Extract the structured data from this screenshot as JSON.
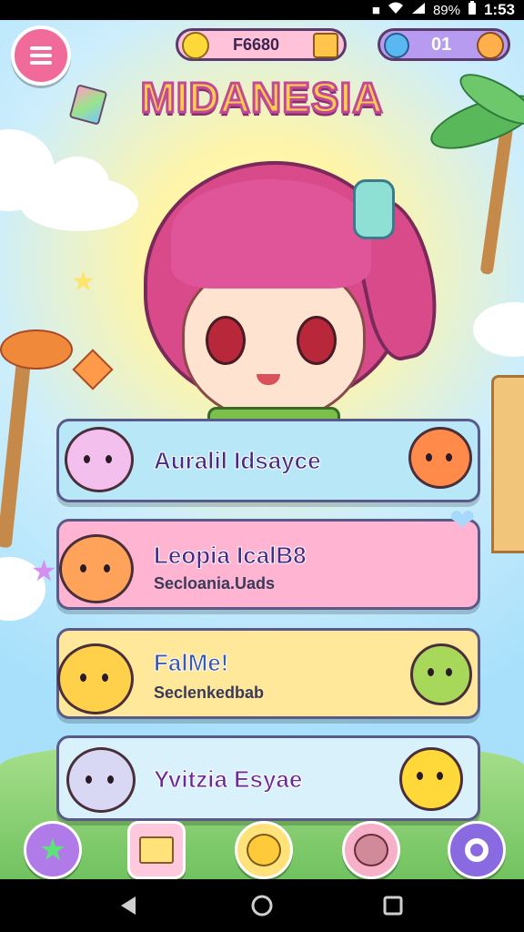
{
  "status_bar": {
    "battery": "89%",
    "time": "1:53"
  },
  "header": {
    "coins_value": "F6680",
    "gems_value": "01"
  },
  "title": "MIDANESIA",
  "menu_cards": [
    {
      "title": "Auralil Idsayce",
      "subtitle": "",
      "color": "#b8e8f8"
    },
    {
      "title": "Leopia IcalB8",
      "subtitle": "Secloania.Uads",
      "color": "#ffb5d2"
    },
    {
      "title": "FalMe!",
      "subtitle": "Seclenkedbab",
      "color": "#ffe89a"
    },
    {
      "title": "Yvitzia Esyae",
      "subtitle": "",
      "color": "#d8f1fb"
    }
  ],
  "colors": {
    "accent_pink": "#f06a9a",
    "accent_purple": "#9b6fe0",
    "outline": "#5a3b6b"
  },
  "icons": {
    "menu": "menu-icon",
    "coin": "coin-icon",
    "gem": "gem-icon",
    "star": "star-icon",
    "quest": "quest-board-icon",
    "pet": "pet-icon",
    "settings": "settings-icon"
  }
}
